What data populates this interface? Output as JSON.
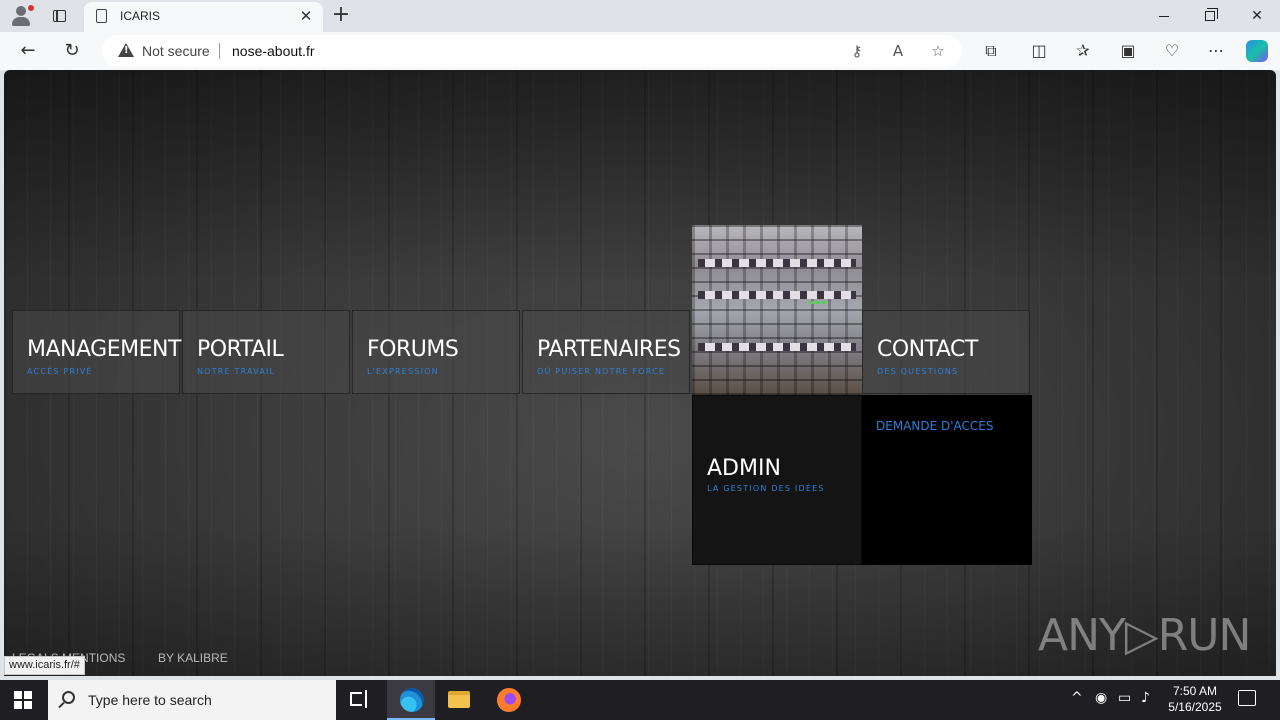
{
  "browser": {
    "tab_title": "ICARIS",
    "new_tab_label": "+",
    "security_label": "Not secure",
    "url": "nose-about.fr",
    "status_url": "www.icaris.fr/#"
  },
  "nav": {
    "tiles": [
      {
        "title": "MANAGEMENT",
        "subtitle": "ACCÈS PRIVÉ"
      },
      {
        "title": "PORTAIL",
        "subtitle": "NOTRE TRAVAIL"
      },
      {
        "title": "FORUMS",
        "subtitle": "L'EXPRESSION"
      },
      {
        "title": "PARTENAIRES",
        "subtitle": "OÙ PUISER NOTRE FORCE"
      },
      {
        "title": "CONTACT",
        "subtitle": "DES QUESTIONS"
      }
    ],
    "admin": {
      "title": "ADMIN",
      "subtitle": "LA GESTION DES IDÉES"
    },
    "access_request": "DEMANDE D'ACCÈS"
  },
  "footer": {
    "legal": "LEGALS MENTIONS",
    "credit": "BY KALIBRE"
  },
  "watermark": "ANY▷RUN",
  "taskbar": {
    "search_placeholder": "Type here to search",
    "time": "7:50 AM",
    "date": "5/16/2025"
  },
  "colors": {
    "accent_blue": "#2f7fd6",
    "page_bg": "#3a3a3a"
  }
}
